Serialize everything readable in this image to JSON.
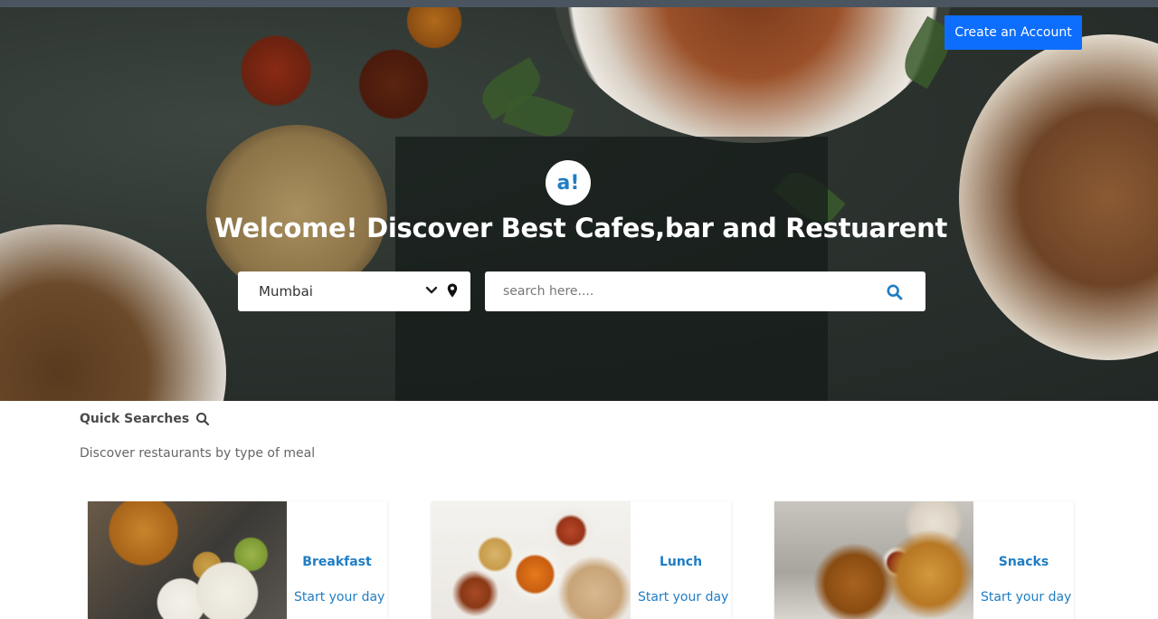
{
  "header": {
    "create_account_label": "Create an Account",
    "logo_text": "a!",
    "welcome_text": "Welcome! Discover Best Cafes,bar and Restuarent"
  },
  "search": {
    "city_value": "Mumbai",
    "placeholder": "search here...."
  },
  "quick_searches": {
    "title": "Quick Searches",
    "subtitle": "Discover restaurants by type of meal",
    "cards": [
      {
        "title": "Breakfast",
        "desc": "Start your day"
      },
      {
        "title": "Lunch",
        "desc": "Start your day"
      },
      {
        "title": "Snacks",
        "desc": "Start your day"
      }
    ]
  },
  "colors": {
    "accent": "#0d6efd",
    "link": "#1f7dc4"
  }
}
